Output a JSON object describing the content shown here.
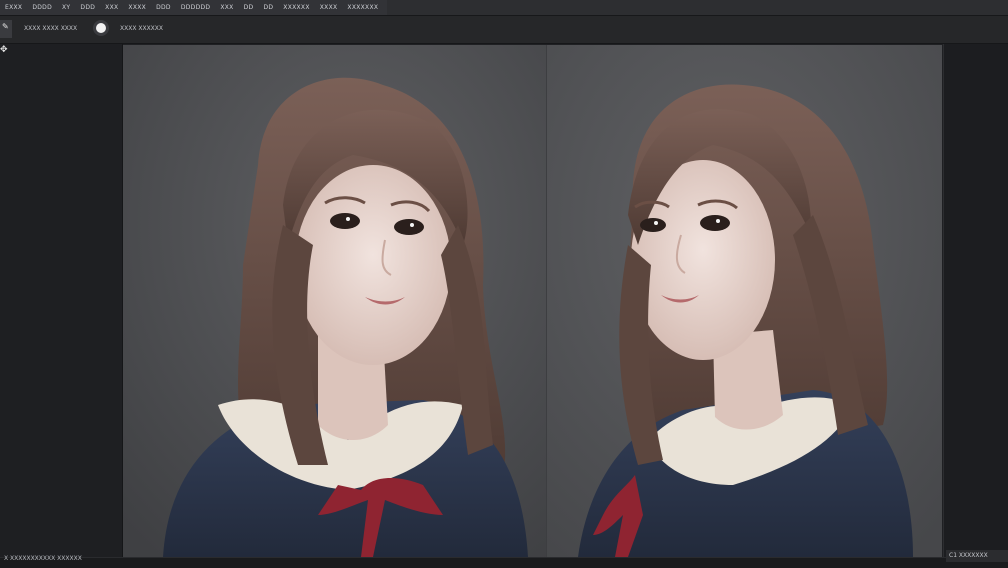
{
  "menu": {
    "items": [
      "EXXX",
      "DDDD",
      "XY",
      "DDD",
      "XXX",
      "XXXX",
      "DDD",
      "DDDDDD",
      "XXX",
      "DD",
      "DD",
      "XXXXXX",
      "XXXX",
      "XXXXXXX"
    ]
  },
  "options": {
    "tool_label": "XXXX XXXX XXXX",
    "brush_label": "XXXX XXXXXX"
  },
  "status": {
    "left": "X   XXXXXXXXXXX  XXXXXX",
    "right": "C1   XXXXXXX"
  },
  "canvas": {
    "background_color": "#505154",
    "left_figure": "portrait-girl-facing-front",
    "right_figure": "portrait-girl-three-quarter"
  },
  "colors": {
    "hair": "#6a4f45",
    "sweater": "#2b3348",
    "collar": "#e9e2d7",
    "ribbon": "#8f2431",
    "skin": "#e9d8d2"
  }
}
